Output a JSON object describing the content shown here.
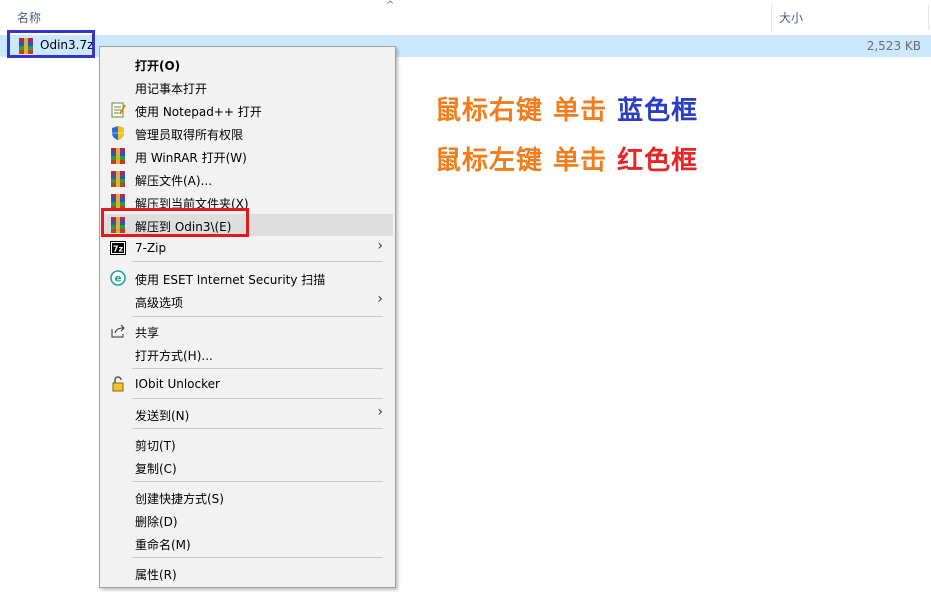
{
  "header": {
    "name_col": "名称",
    "size_col": "大小",
    "sort_arrow": "^"
  },
  "file": {
    "name": "Odin3.7z",
    "size": "2,523 KB"
  },
  "menu": {
    "open": "打开(O)",
    "open_notepad": "用记事本打开",
    "open_notepadpp": "使用 Notepad++ 打开",
    "admin_take": "管理员取得所有权限",
    "open_winrar": "用 WinRAR 打开(W)",
    "extract_files": "解压文件(A)...",
    "extract_here": "解压到当前文件夹(X)",
    "extract_to": "解压到 Odin3\\(E)",
    "sevenzip": "7-Zip",
    "eset": "使用 ESET Internet Security 扫描",
    "advanced": "高级选项",
    "share": "共享",
    "open_with": "打开方式(H)...",
    "iobit": "IObit Unlocker",
    "send_to": "发送到(N)",
    "cut": "剪切(T)",
    "copy": "复制(C)",
    "create_shortcut": "创建快捷方式(S)",
    "delete": "删除(D)",
    "rename": "重命名(M)",
    "properties": "属性(R)",
    "submenu_arrow": "›"
  },
  "annotations": {
    "line1_a": "鼠标右键",
    "line1_b": "单击",
    "line1_c": "蓝色框",
    "line2_a": "鼠标左键",
    "line2_b": "单击",
    "line2_c": "红色框"
  },
  "colors": {
    "selection": "#cce8ff",
    "blue_frame": "#3535c8",
    "red_frame": "#e21a1a",
    "annotation_orange": "#f07d1e",
    "annotation_blue": "#2b3dc4",
    "annotation_red": "#e82424"
  },
  "icons": {
    "file": "winrar-archive-icon",
    "notepadpp": "notepadpp-icon",
    "admin": "uac-shield-icon",
    "winrar": "winrar-icon",
    "sevenzip": "7zip-icon",
    "eset": "eset-icon",
    "share": "share-icon",
    "iobit": "lock-icon"
  }
}
